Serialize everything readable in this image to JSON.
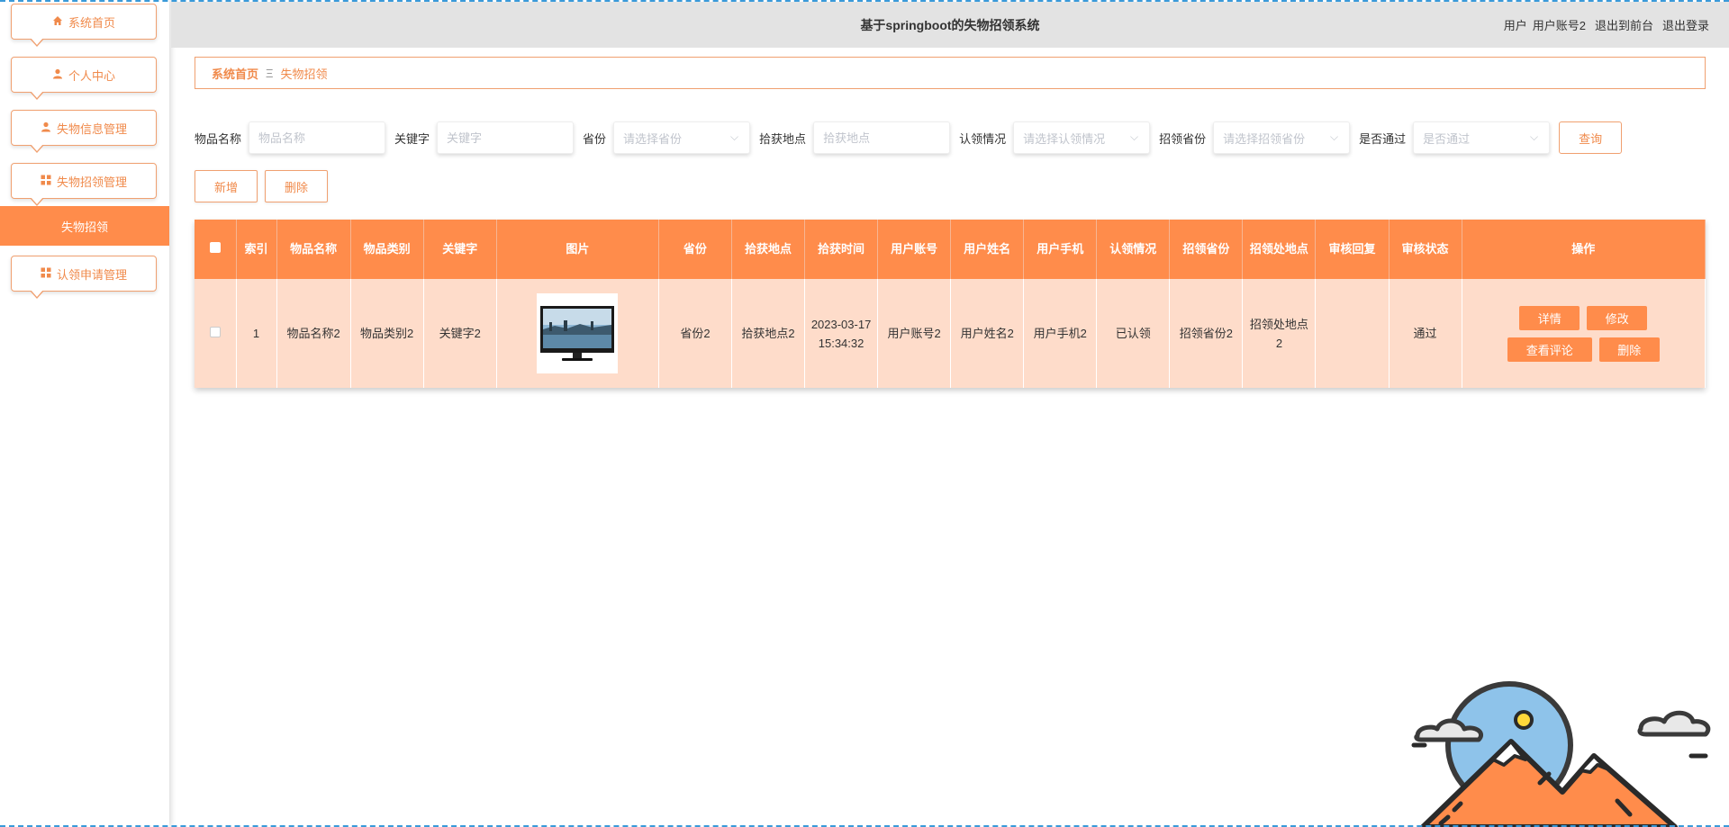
{
  "sidebar": {
    "items": [
      {
        "label": "系统首页",
        "icon": "home-icon"
      },
      {
        "label": "个人中心",
        "icon": "user-icon"
      },
      {
        "label": "失物信息管理",
        "icon": "user-icon"
      },
      {
        "label": "失物招领管理",
        "icon": "grid-icon"
      },
      {
        "label": "认领申请管理",
        "icon": "grid-icon"
      }
    ],
    "active_sub": "失物招领"
  },
  "header": {
    "title": "基于springboot的失物招领系统",
    "user_role": "用户",
    "user_name": "用户账号2",
    "front_link": "退出到前台",
    "logout": "退出登录"
  },
  "breadcrumb": {
    "home": "系统首页",
    "sep": "Ξ",
    "current": "失物招领"
  },
  "search": {
    "name_label": "物品名称",
    "name_placeholder": "物品名称",
    "keyword_label": "关键字",
    "keyword_placeholder": "关键字",
    "province_label": "省份",
    "province_placeholder": "请选择省份",
    "place_label": "拾获地点",
    "place_placeholder": "拾获地点",
    "claim_label": "认领情况",
    "claim_placeholder": "请选择认领情况",
    "claim_prov_label": "招领省份",
    "claim_prov_placeholder": "请选择招领省份",
    "pass_label": "是否通过",
    "pass_placeholder": "是否通过",
    "query_label": "查询"
  },
  "actions": {
    "add": "新增",
    "delete": "删除"
  },
  "table": {
    "headers": [
      "索引",
      "物品名称",
      "物品类别",
      "关键字",
      "图片",
      "省份",
      "拾获地点",
      "拾获时间",
      "用户账号",
      "用户姓名",
      "用户手机",
      "认领情况",
      "招领省份",
      "招领处地点",
      "审核回复",
      "审核状态",
      "操作"
    ],
    "rows": [
      {
        "index": "1",
        "name": "物品名称2",
        "category": "物品类别2",
        "keyword": "关键字2",
        "province": "省份2",
        "place": "拾获地点2",
        "time": "2023-03-17 15:34:32",
        "account": "用户账号2",
        "username": "用户姓名2",
        "phone": "用户手机2",
        "claim": "已认领",
        "claim_province": "招领省份2",
        "claim_place": "招领处地点2",
        "reply": "",
        "status": "通过"
      }
    ],
    "row_ops": {
      "detail": "详情",
      "edit": "修改",
      "comments": "查看评论",
      "delete": "删除"
    }
  },
  "colors": {
    "accent": "#ff8c4b",
    "row_bg": "#fedcca",
    "header_bg": "#e3e3e3"
  }
}
